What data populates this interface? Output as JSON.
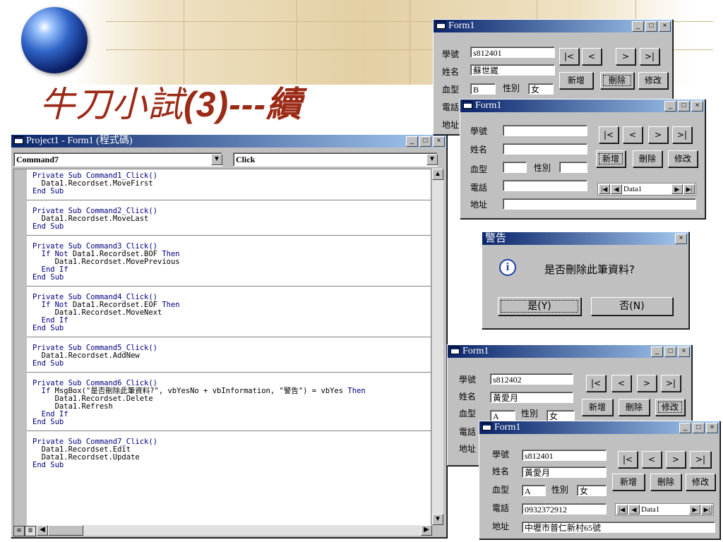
{
  "slide": {
    "title_main": "牛刀小試",
    "title_paren": "(3)",
    "title_tail": "---續"
  },
  "code_window": {
    "title": "Project1 - Form1 (程式碼)",
    "object_combo": "Command7",
    "proc_combo": "Click",
    "blocks": [
      [
        [
          {
            "t": "Private Sub Command1_Click()",
            "k": 1
          }
        ],
        [
          {
            "t": "  Data1.Recordset.MoveFirst"
          }
        ],
        [
          {
            "t": "End Sub",
            "k": 1
          }
        ]
      ],
      [
        [
          {
            "t": "Private Sub Command2_Click()",
            "k": 1
          }
        ],
        [
          {
            "t": "  Data1.Recordset.MoveLast"
          }
        ],
        [
          {
            "t": "End Sub",
            "k": 1
          }
        ]
      ],
      [
        [
          {
            "t": "Private Sub Command3_Click()",
            "k": 1
          }
        ],
        [
          {
            "t": "  If Not",
            "k": 1
          },
          {
            "t": " Data1.Recordset.BOF "
          },
          {
            "t": "Then",
            "k": 1
          }
        ],
        [
          {
            "t": "     Data1.Recordset.MovePrevious"
          }
        ],
        [
          {
            "t": "  End If",
            "k": 1
          }
        ],
        [
          {
            "t": "End Sub",
            "k": 1
          }
        ]
      ],
      [
        [
          {
            "t": "Private Sub Command4_Click()",
            "k": 1
          }
        ],
        [
          {
            "t": "  If Not",
            "k": 1
          },
          {
            "t": " Data1.Recordset.EOF "
          },
          {
            "t": "Then",
            "k": 1
          }
        ],
        [
          {
            "t": "     Data1.Recordset.MoveNext"
          }
        ],
        [
          {
            "t": "  End If",
            "k": 1
          }
        ],
        [
          {
            "t": "End Sub",
            "k": 1
          }
        ]
      ],
      [
        [
          {
            "t": "Private Sub Command5_Click()",
            "k": 1
          }
        ],
        [
          {
            "t": "  Data1.Recordset.AddNew"
          }
        ],
        [
          {
            "t": "End Sub",
            "k": 1
          }
        ]
      ],
      [
        [
          {
            "t": "Private Sub Command6_Click()",
            "k": 1
          }
        ],
        [
          {
            "t": "  If",
            "k": 1
          },
          {
            "t": " MsgBox(\"是否刪除此筆資料?\", vbYesNo + vbInformation, \"警告\") = vbYes "
          },
          {
            "t": "Then",
            "k": 1
          }
        ],
        [
          {
            "t": "     Data1.Recordset.Delete"
          }
        ],
        [
          {
            "t": "     Data1.Refresh"
          }
        ],
        [
          {
            "t": "  End If",
            "k": 1
          }
        ],
        [
          {
            "t": "End Sub",
            "k": 1
          }
        ]
      ],
      [
        [
          {
            "t": "Private Sub Command7_Click()",
            "k": 1
          }
        ],
        [
          {
            "t": "  Data1.Recordset.Edit"
          }
        ],
        [
          {
            "t": "  Data1.Recordset.Update"
          }
        ],
        [
          {
            "t": "End Sub",
            "k": 1
          }
        ]
      ]
    ]
  },
  "labels": {
    "student_id": "學號",
    "name": "姓名",
    "blood": "血型",
    "gender": "性別",
    "phone": "電話",
    "address": "地址",
    "btn_first": "|<",
    "btn_prev": "<",
    "btn_next": ">",
    "btn_last": ">|",
    "btn_add": "新增",
    "btn_delete": "刪除",
    "btn_modify": "修改",
    "data_caption": "Data1"
  },
  "form_a": {
    "title": "Form1",
    "student_id": "s812401",
    "name": "蘇世崴",
    "blood": "B",
    "gender": "女"
  },
  "form_b": {
    "title": "Form1",
    "student_id": "",
    "name": "",
    "blood": "",
    "gender": "",
    "phone": "",
    "address": ""
  },
  "dialog": {
    "title": "警告",
    "message": "是否刪除此筆資料?",
    "yes": "是(Y)",
    "no": "否(N)"
  },
  "form_c": {
    "title": "Form1",
    "student_id": "s812402",
    "name": "黃愛月",
    "blood": "A",
    "gender": "女"
  },
  "form_d": {
    "title": "Form1",
    "student_id": "s812401",
    "name": "黃愛月",
    "blood": "A",
    "gender": "女",
    "phone": "0932372912",
    "address": "中壢市普仁新村65號"
  }
}
